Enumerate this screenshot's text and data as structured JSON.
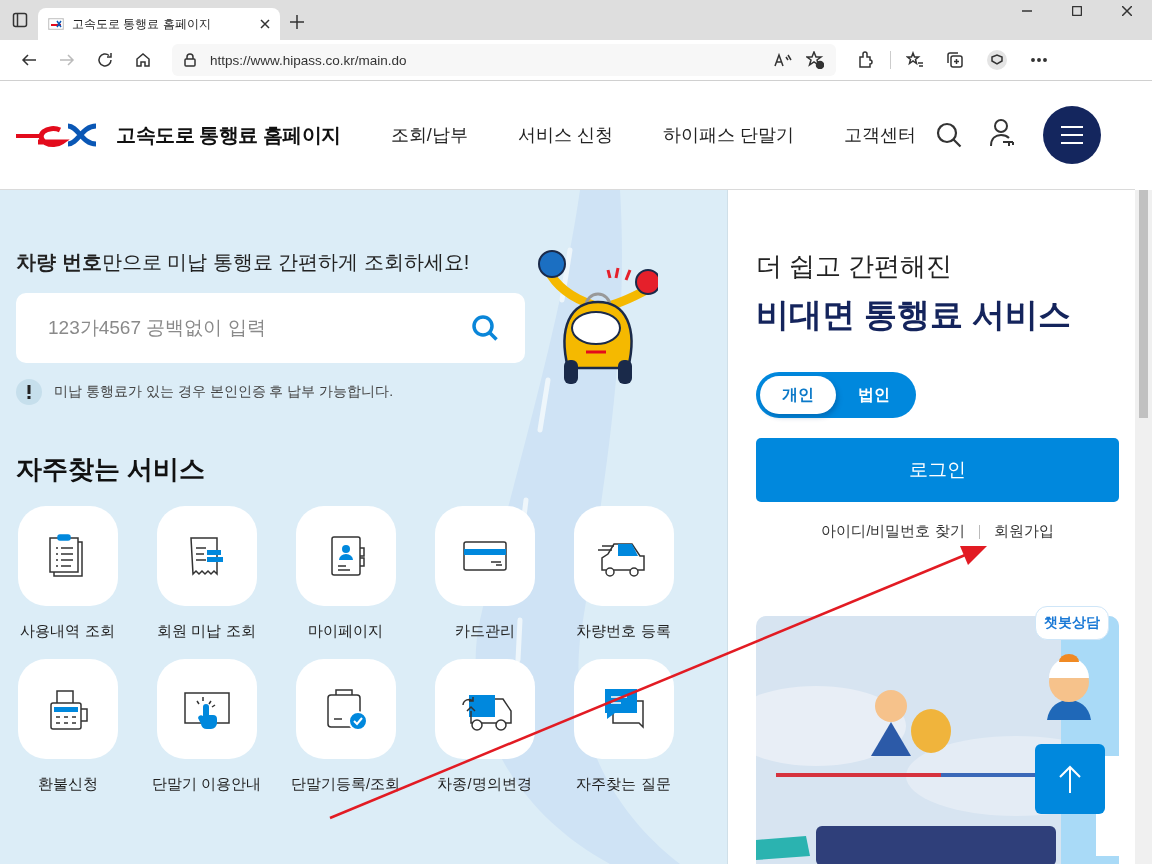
{
  "browser": {
    "tab_title": "고속도로 통행료 홈페이지",
    "url": "https://www.hipass.co.kr/main.do"
  },
  "header": {
    "logo_text": "고속도로 통행료 홈페이지",
    "nav": [
      "조회/납부",
      "서비스 신청",
      "하이패스 단말기",
      "고객센터"
    ]
  },
  "lookup": {
    "headline": "**차량 번호**만으로 미납 통행료 간편하게 조회하세요!",
    "search": {
      "placeholder": "123가4567 공백없이 입력"
    },
    "notice": "미납 통행료가 있는 경우 본인인증 후 납부 가능합니다."
  },
  "services": {
    "title": "자주찾는 서비스",
    "items": [
      {
        "label": "사용내역 조회"
      },
      {
        "label": "회원 미납 조회"
      },
      {
        "label": "마이페이지"
      },
      {
        "label": "카드관리"
      },
      {
        "label": "차량번호 등록"
      },
      {
        "label": "환불신청"
      },
      {
        "label": "단말기 이용안내"
      },
      {
        "label": "단말기등록/조회"
      },
      {
        "label": "차종/명의변경"
      },
      {
        "label": "자주찾는 질문"
      }
    ]
  },
  "login": {
    "subtitle": "더 쉽고 간편해진",
    "title": "비대면 통행료 서비스",
    "member_types": [
      {
        "label": "개인",
        "selected": true
      },
      {
        "label": "법인",
        "selected": false
      }
    ],
    "login_button": "로그인",
    "links": [
      "아이디/비밀번호 찾기",
      "회원가입"
    ]
  },
  "chatbot": {
    "label": "챗봇상담"
  }
}
